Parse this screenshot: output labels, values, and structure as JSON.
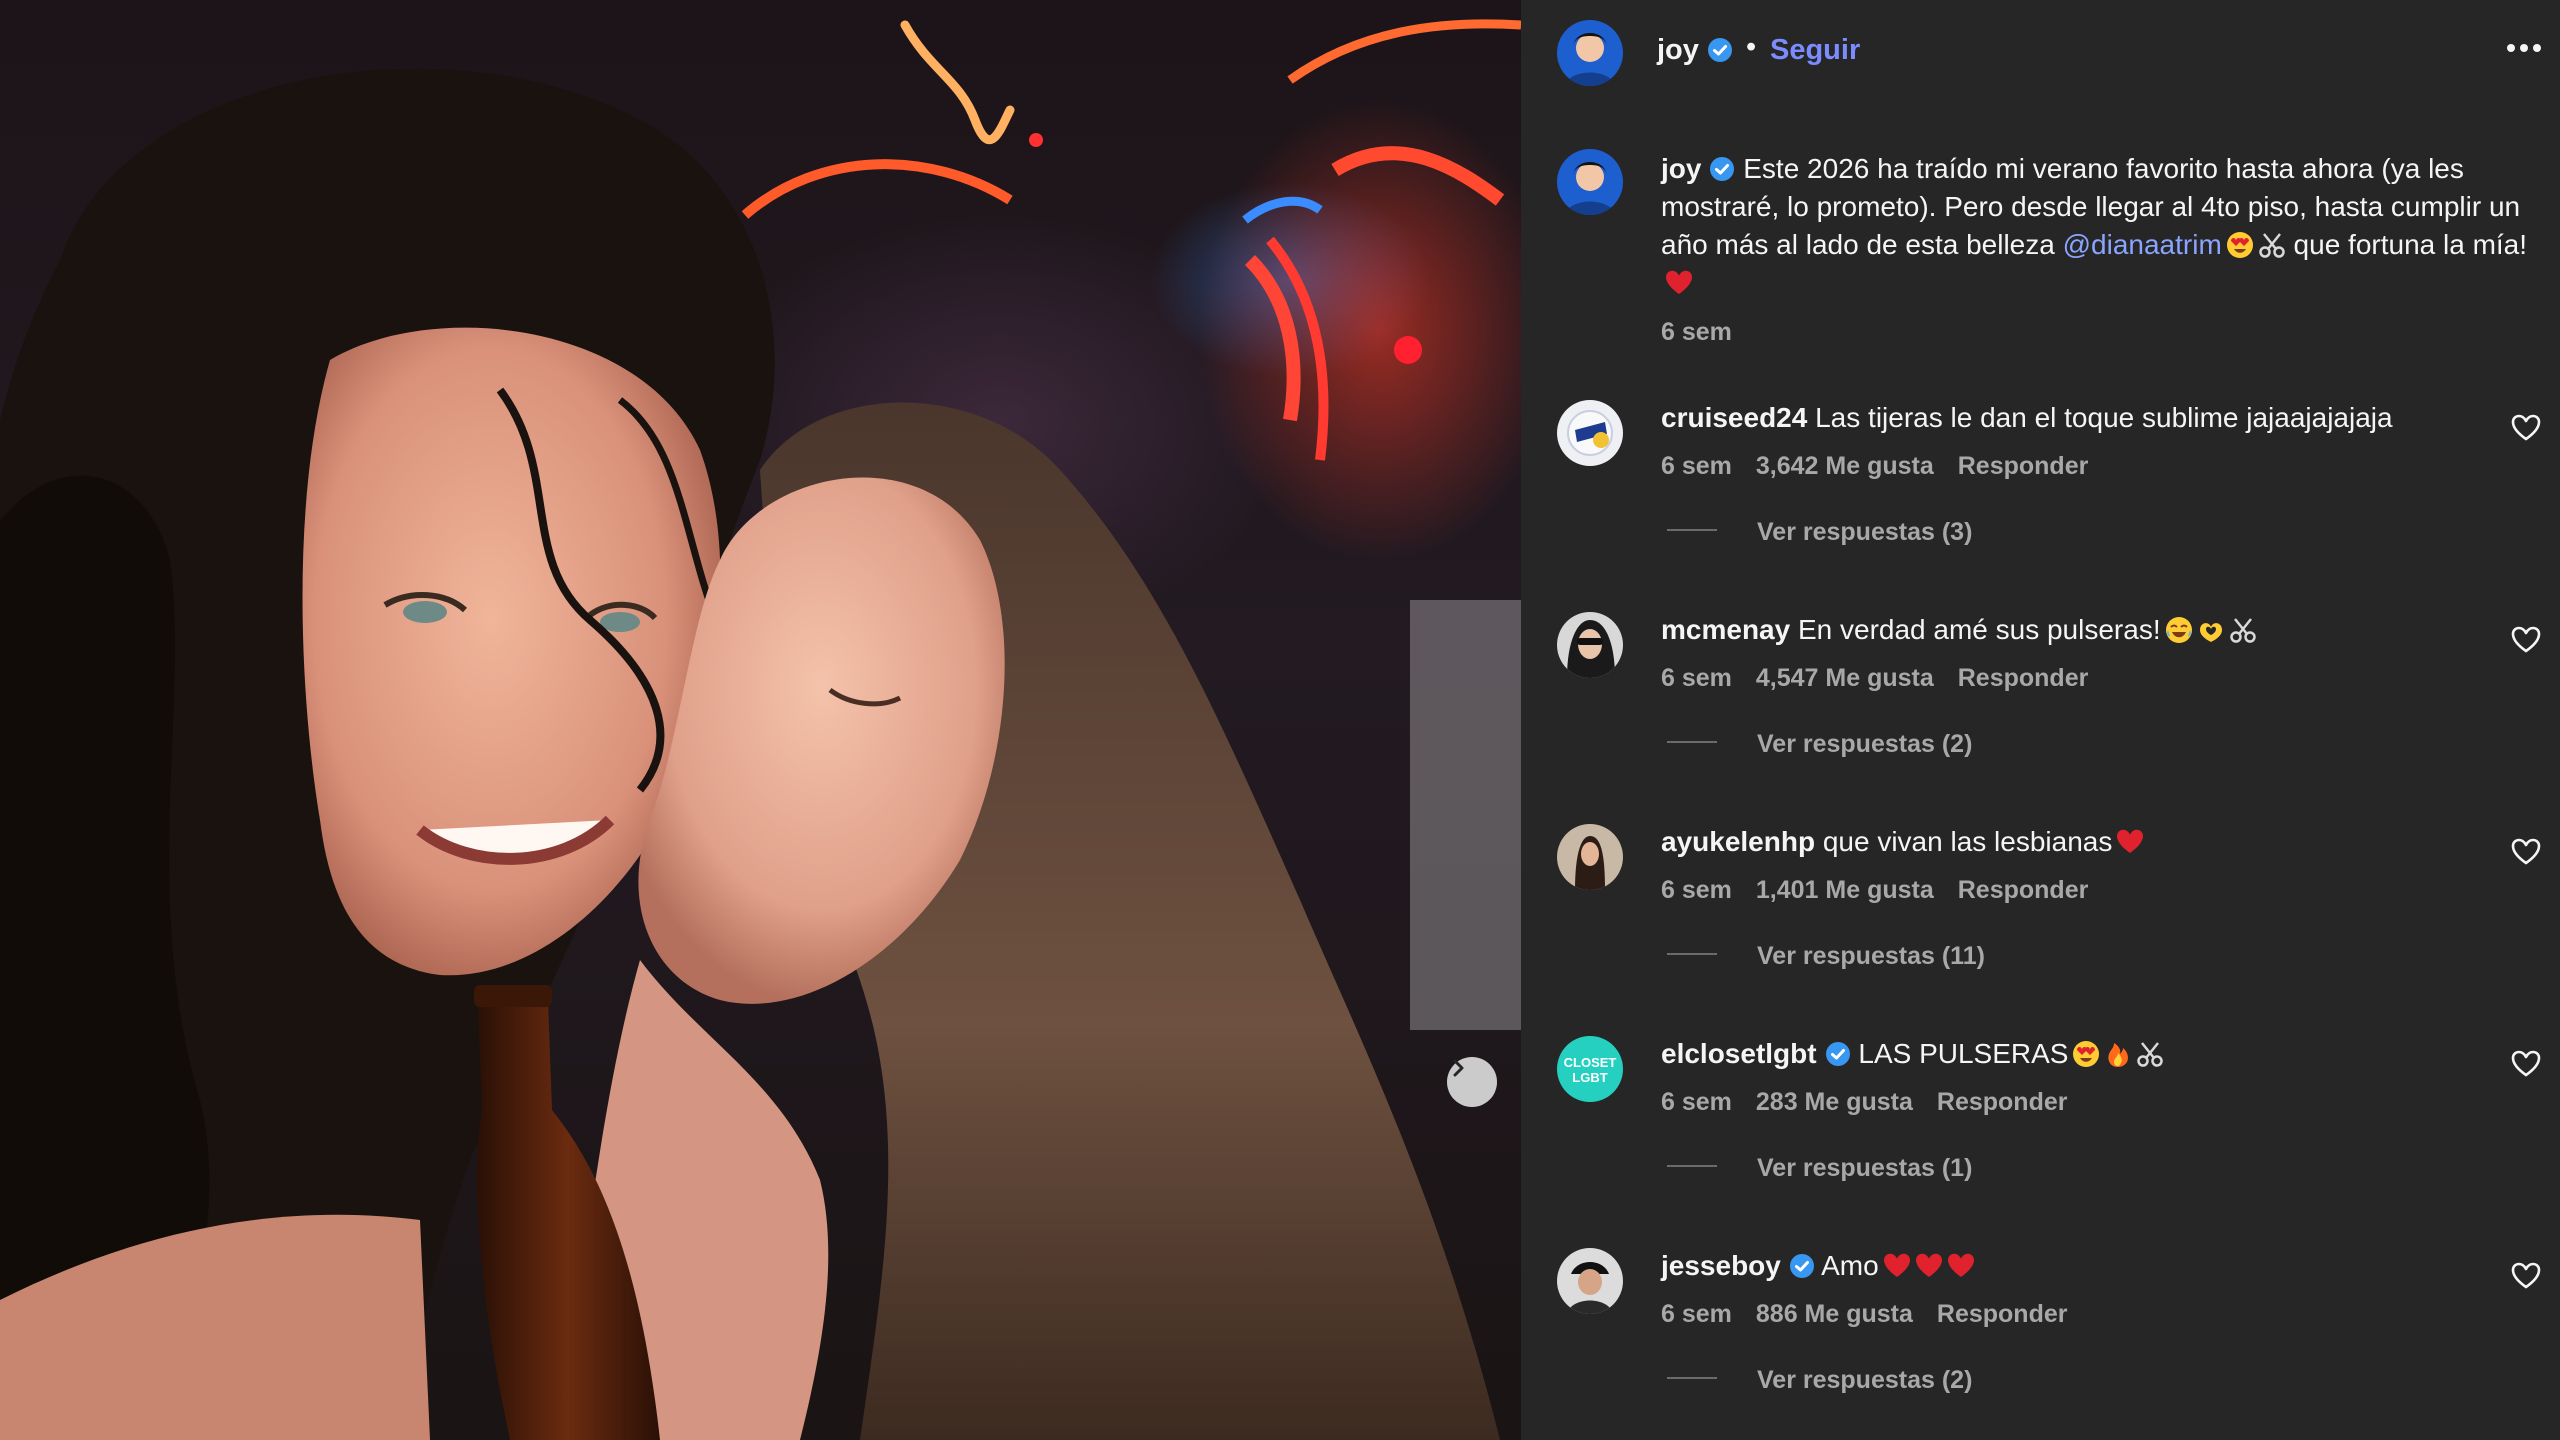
{
  "post": {
    "author": "joy",
    "follow_label": "Seguir",
    "separator": "•",
    "caption": {
      "author": "joy",
      "text_before_mention": "Este 2026 ha traído mi verano favorito hasta ahora (ya les mostraré, lo prometo). Pero desde llegar al 4to piso, hasta cumplir un año más al lado de esta belleza",
      "mention": "@dianaatrim",
      "text_after_mention": "que fortuna la mía!",
      "emojis_after_mention": [
        "heart-eyes-emoji",
        "scissors-emoji"
      ],
      "emoji_end": "red-heart-emoji",
      "time": "6 sem"
    }
  },
  "comments": [
    {
      "user": "cruiseed24",
      "verified": false,
      "text": "Las tijeras le dan el toque sublime jajaajajajaja",
      "emojis": [],
      "time": "6 sem",
      "likes": "3,642 Me gusta",
      "reply_label": "Responder",
      "replies_label": "Ver respuestas (3)"
    },
    {
      "user": "mcmenay",
      "verified": false,
      "text": "En verdad amé sus pulseras!",
      "emojis": [
        "tears-of-joy-emoji",
        "heart-hands-emoji",
        "scissors-emoji"
      ],
      "time": "6 sem",
      "likes": "4,547 Me gusta",
      "reply_label": "Responder",
      "replies_label": "Ver respuestas (2)"
    },
    {
      "user": "ayukelenhp",
      "verified": false,
      "text": "que vivan las lesbianas",
      "emojis": [
        "red-heart-emoji"
      ],
      "time": "6 sem",
      "likes": "1,401 Me gusta",
      "reply_label": "Responder",
      "replies_label": "Ver respuestas (11)"
    },
    {
      "user": "elclosetlgbt",
      "verified": true,
      "text": "LAS PULSERAS",
      "emojis": [
        "heart-eyes-emoji",
        "fire-emoji",
        "scissors-emoji"
      ],
      "time": "6 sem",
      "likes": "283 Me gusta",
      "reply_label": "Responder",
      "replies_label": "Ver respuestas (1)"
    },
    {
      "user": "jesseboy",
      "verified": true,
      "text": "Amo",
      "emojis": [
        "red-heart-emoji",
        "red-heart-emoji",
        "red-heart-emoji"
      ],
      "time": "6 sem",
      "likes": "886 Me gusta",
      "reply_label": "Responder",
      "replies_label": "Ver respuestas (2)"
    }
  ],
  "avatar_lettering": {
    "elclosetlgbt": "CLOSET LGBT"
  },
  "colors": {
    "panel_bg": "#262626",
    "link": "#7b8cff",
    "mention": "#8aa4ff",
    "verified": "#3897f0",
    "muted": "#a8a8a8",
    "heart": "#e0212e"
  }
}
